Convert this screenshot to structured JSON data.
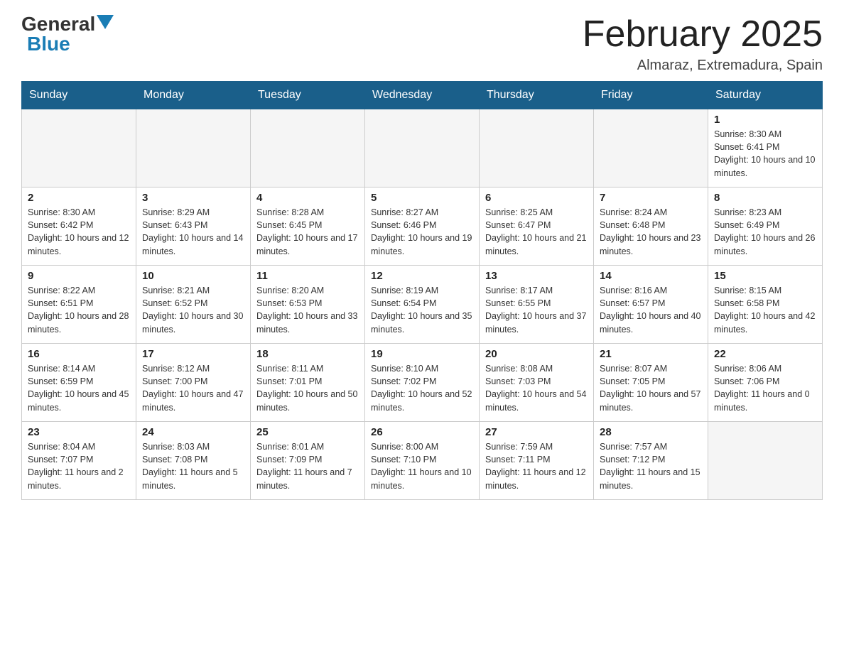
{
  "header": {
    "logo_general": "General",
    "logo_blue": "Blue",
    "title": "February 2025",
    "subtitle": "Almaraz, Extremadura, Spain"
  },
  "weekdays": [
    "Sunday",
    "Monday",
    "Tuesday",
    "Wednesday",
    "Thursday",
    "Friday",
    "Saturday"
  ],
  "weeks": [
    [
      {
        "day": "",
        "info": ""
      },
      {
        "day": "",
        "info": ""
      },
      {
        "day": "",
        "info": ""
      },
      {
        "day": "",
        "info": ""
      },
      {
        "day": "",
        "info": ""
      },
      {
        "day": "",
        "info": ""
      },
      {
        "day": "1",
        "info": "Sunrise: 8:30 AM\nSunset: 6:41 PM\nDaylight: 10 hours and 10 minutes."
      }
    ],
    [
      {
        "day": "2",
        "info": "Sunrise: 8:30 AM\nSunset: 6:42 PM\nDaylight: 10 hours and 12 minutes."
      },
      {
        "day": "3",
        "info": "Sunrise: 8:29 AM\nSunset: 6:43 PM\nDaylight: 10 hours and 14 minutes."
      },
      {
        "day": "4",
        "info": "Sunrise: 8:28 AM\nSunset: 6:45 PM\nDaylight: 10 hours and 17 minutes."
      },
      {
        "day": "5",
        "info": "Sunrise: 8:27 AM\nSunset: 6:46 PM\nDaylight: 10 hours and 19 minutes."
      },
      {
        "day": "6",
        "info": "Sunrise: 8:25 AM\nSunset: 6:47 PM\nDaylight: 10 hours and 21 minutes."
      },
      {
        "day": "7",
        "info": "Sunrise: 8:24 AM\nSunset: 6:48 PM\nDaylight: 10 hours and 23 minutes."
      },
      {
        "day": "8",
        "info": "Sunrise: 8:23 AM\nSunset: 6:49 PM\nDaylight: 10 hours and 26 minutes."
      }
    ],
    [
      {
        "day": "9",
        "info": "Sunrise: 8:22 AM\nSunset: 6:51 PM\nDaylight: 10 hours and 28 minutes."
      },
      {
        "day": "10",
        "info": "Sunrise: 8:21 AM\nSunset: 6:52 PM\nDaylight: 10 hours and 30 minutes."
      },
      {
        "day": "11",
        "info": "Sunrise: 8:20 AM\nSunset: 6:53 PM\nDaylight: 10 hours and 33 minutes."
      },
      {
        "day": "12",
        "info": "Sunrise: 8:19 AM\nSunset: 6:54 PM\nDaylight: 10 hours and 35 minutes."
      },
      {
        "day": "13",
        "info": "Sunrise: 8:17 AM\nSunset: 6:55 PM\nDaylight: 10 hours and 37 minutes."
      },
      {
        "day": "14",
        "info": "Sunrise: 8:16 AM\nSunset: 6:57 PM\nDaylight: 10 hours and 40 minutes."
      },
      {
        "day": "15",
        "info": "Sunrise: 8:15 AM\nSunset: 6:58 PM\nDaylight: 10 hours and 42 minutes."
      }
    ],
    [
      {
        "day": "16",
        "info": "Sunrise: 8:14 AM\nSunset: 6:59 PM\nDaylight: 10 hours and 45 minutes."
      },
      {
        "day": "17",
        "info": "Sunrise: 8:12 AM\nSunset: 7:00 PM\nDaylight: 10 hours and 47 minutes."
      },
      {
        "day": "18",
        "info": "Sunrise: 8:11 AM\nSunset: 7:01 PM\nDaylight: 10 hours and 50 minutes."
      },
      {
        "day": "19",
        "info": "Sunrise: 8:10 AM\nSunset: 7:02 PM\nDaylight: 10 hours and 52 minutes."
      },
      {
        "day": "20",
        "info": "Sunrise: 8:08 AM\nSunset: 7:03 PM\nDaylight: 10 hours and 54 minutes."
      },
      {
        "day": "21",
        "info": "Sunrise: 8:07 AM\nSunset: 7:05 PM\nDaylight: 10 hours and 57 minutes."
      },
      {
        "day": "22",
        "info": "Sunrise: 8:06 AM\nSunset: 7:06 PM\nDaylight: 11 hours and 0 minutes."
      }
    ],
    [
      {
        "day": "23",
        "info": "Sunrise: 8:04 AM\nSunset: 7:07 PM\nDaylight: 11 hours and 2 minutes."
      },
      {
        "day": "24",
        "info": "Sunrise: 8:03 AM\nSunset: 7:08 PM\nDaylight: 11 hours and 5 minutes."
      },
      {
        "day": "25",
        "info": "Sunrise: 8:01 AM\nSunset: 7:09 PM\nDaylight: 11 hours and 7 minutes."
      },
      {
        "day": "26",
        "info": "Sunrise: 8:00 AM\nSunset: 7:10 PM\nDaylight: 11 hours and 10 minutes."
      },
      {
        "day": "27",
        "info": "Sunrise: 7:59 AM\nSunset: 7:11 PM\nDaylight: 11 hours and 12 minutes."
      },
      {
        "day": "28",
        "info": "Sunrise: 7:57 AM\nSunset: 7:12 PM\nDaylight: 11 hours and 15 minutes."
      },
      {
        "day": "",
        "info": ""
      }
    ]
  ]
}
